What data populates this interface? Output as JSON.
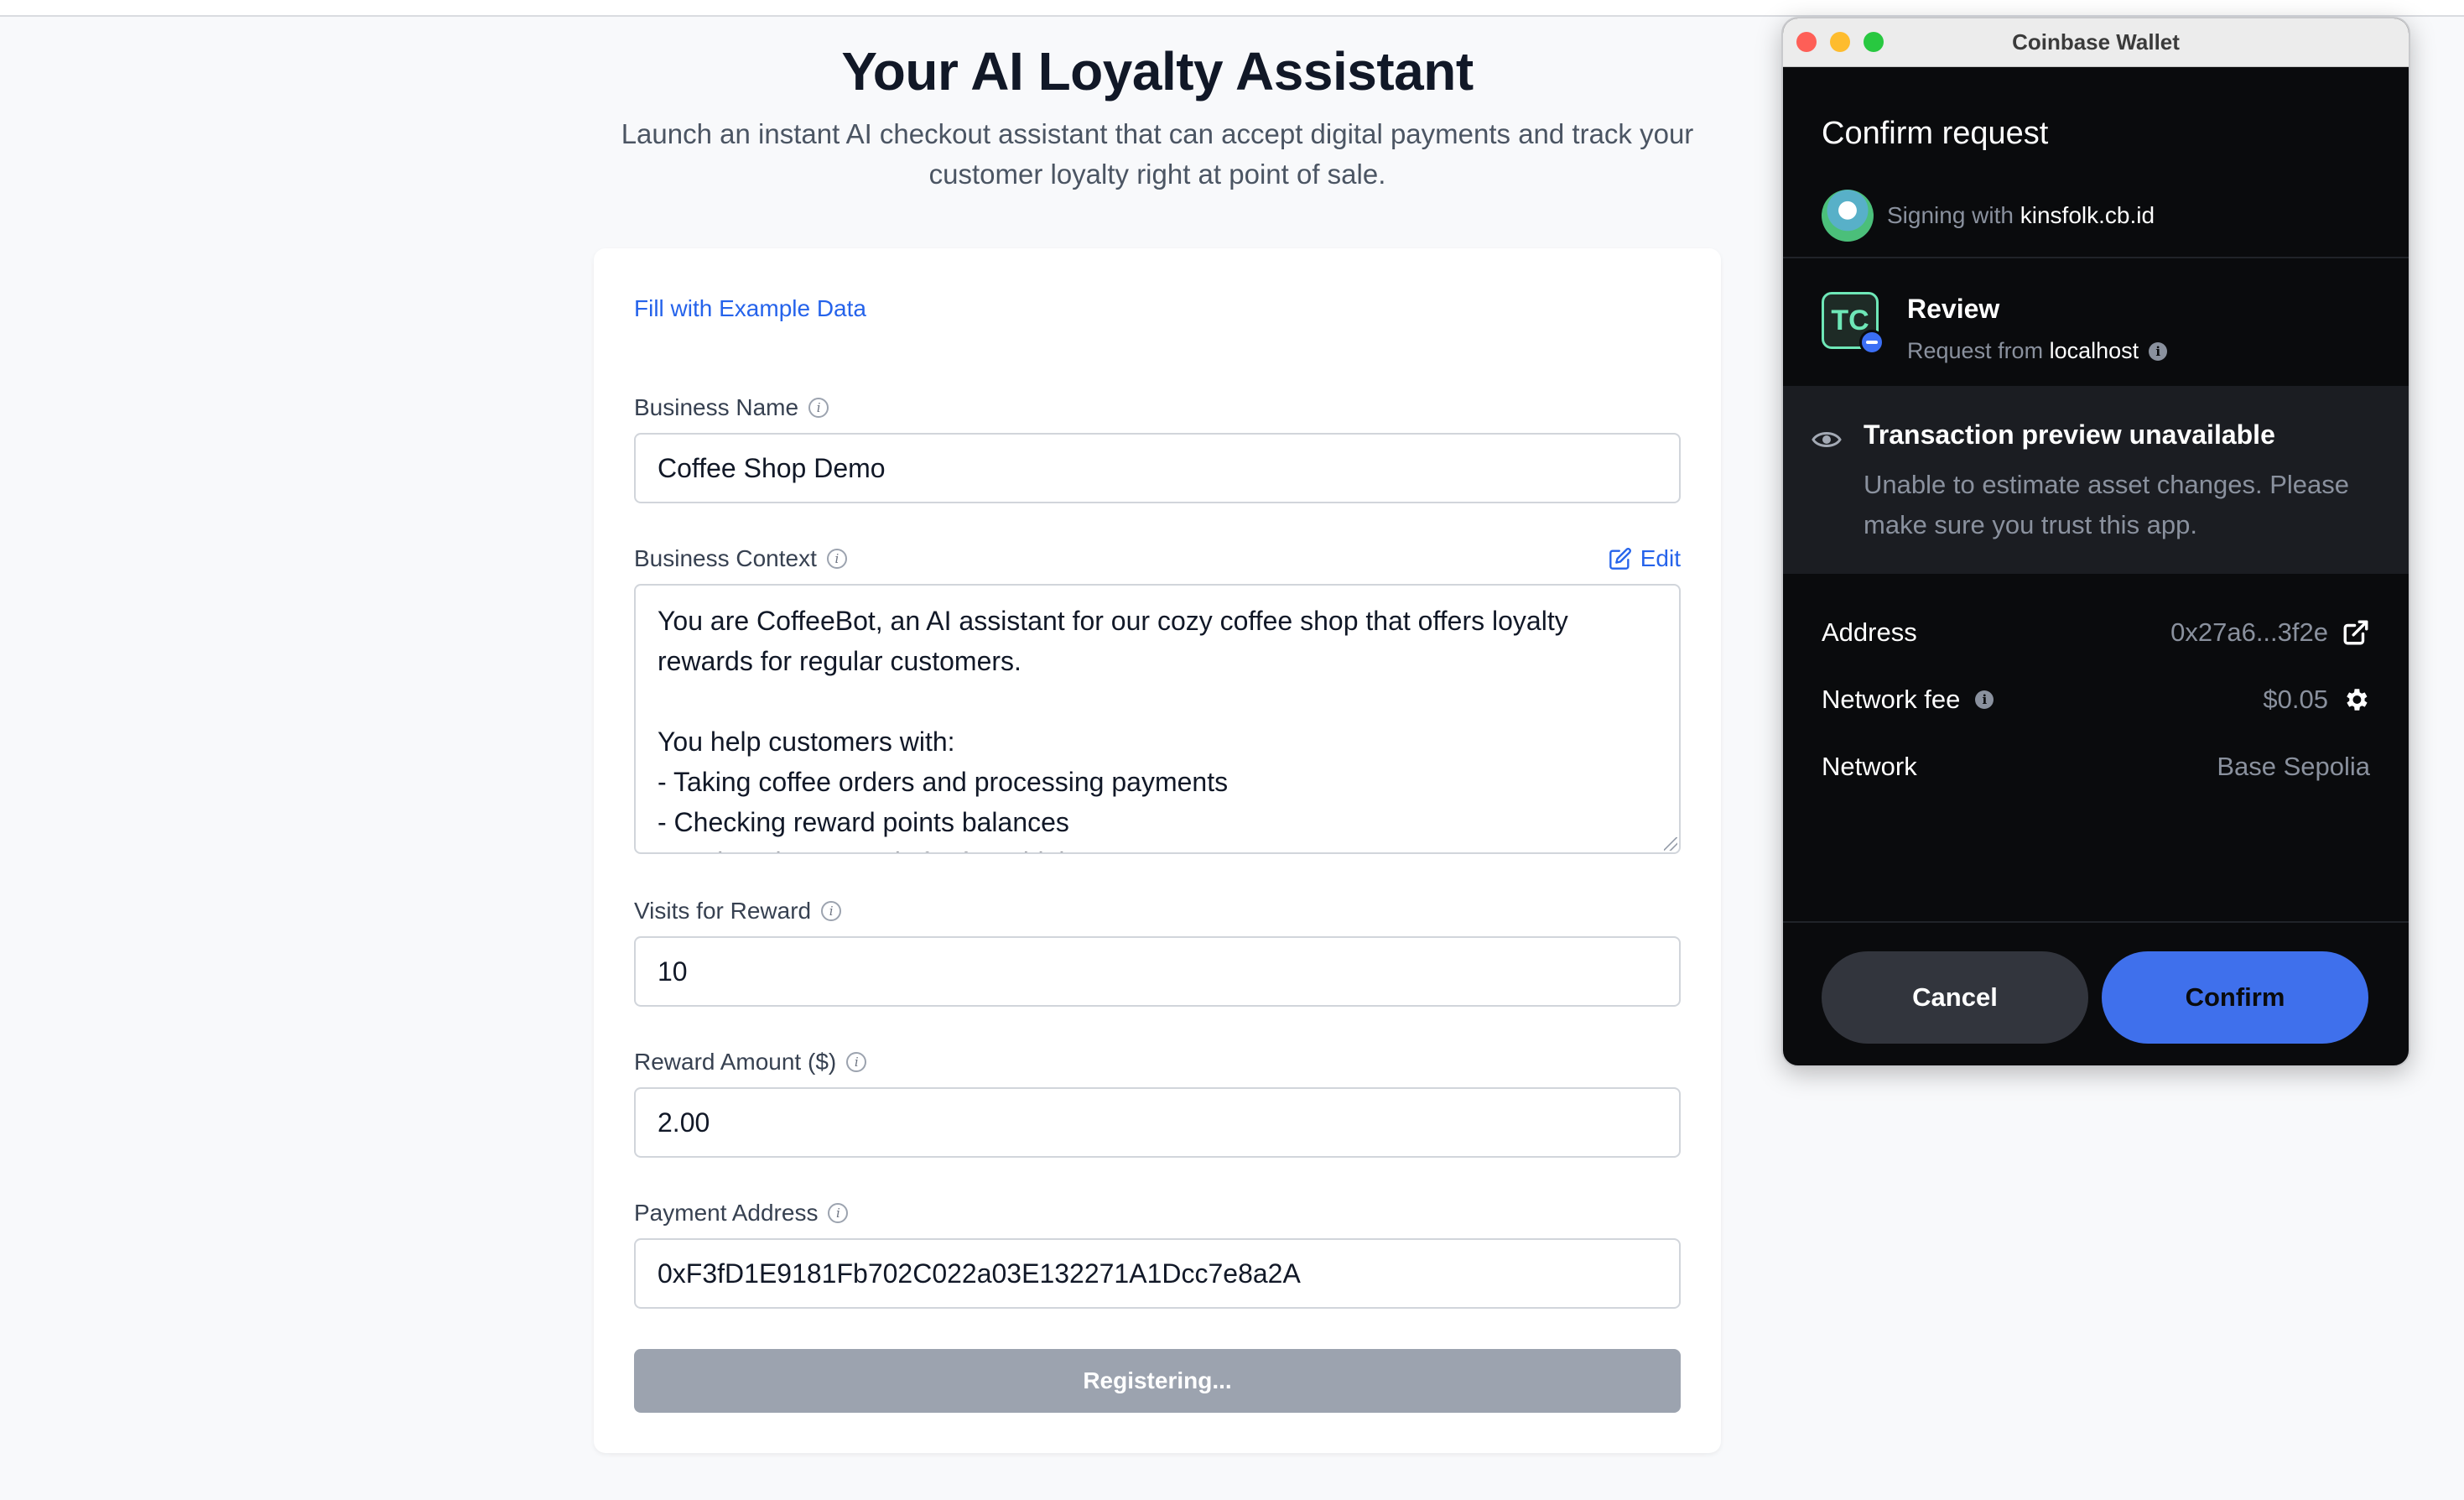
{
  "page": {
    "title": "Your AI Loyalty Assistant",
    "subtitle": "Launch an instant AI checkout assistant that can accept digital payments and track your customer loyalty right at point of sale."
  },
  "form": {
    "fill_example_label": "Fill with Example Data",
    "edit_label": "Edit",
    "business_name": {
      "label": "Business Name",
      "value": "Coffee Shop Demo"
    },
    "business_context": {
      "label": "Business Context",
      "value": "You are CoffeeBot, an AI assistant for our cozy coffee shop that offers loyalty rewards for regular customers.\n\nYou help customers with:\n- Taking coffee orders and processing payments\n- Checking reward points balances\n- Redeeming rewards for free drinks"
    },
    "visits_for_reward": {
      "label": "Visits for Reward",
      "value": "10"
    },
    "reward_amount": {
      "label": "Reward Amount ($)",
      "value": "2.00"
    },
    "payment_address": {
      "label": "Payment Address",
      "value": "0xF3fD1E9181Fb702C022a03E132271A1Dcc7e8a2A"
    },
    "submit_label": "Registering...",
    "submit_state": "disabled"
  },
  "wallet": {
    "window_title": "Coinbase Wallet",
    "heading": "Confirm request",
    "signing_prefix": "Signing with",
    "signing_account": "kinsfolk.cb.id",
    "app_logo_text": "TC",
    "review_title": "Review",
    "request_from_prefix": "Request from",
    "request_from_host": "localhost",
    "preview_title": "Transaction preview unavailable",
    "preview_desc": "Unable to estimate asset changes. Please make sure you trust this app.",
    "rows": {
      "address_label": "Address",
      "address_value": "0x27a6...3f2e",
      "fee_label": "Network fee",
      "fee_value": "$0.05",
      "network_label": "Network",
      "network_value": "Base Sepolia"
    },
    "cancel_label": "Cancel",
    "confirm_label": "Confirm",
    "colors": {
      "confirm": "#3f70ec",
      "cancel": "#32353d",
      "background": "#0a0b0d",
      "link": "#2563eb"
    }
  }
}
